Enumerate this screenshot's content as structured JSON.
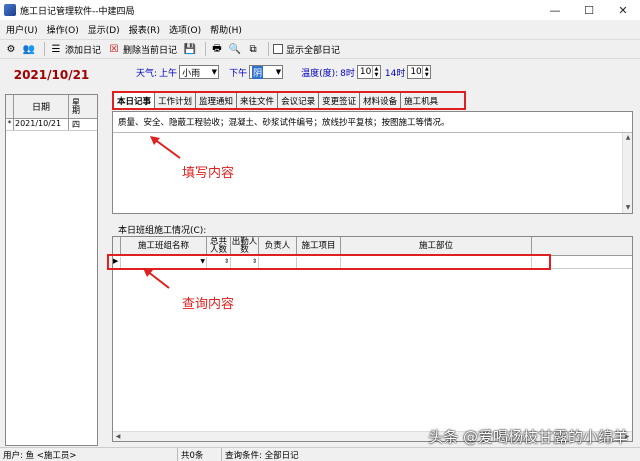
{
  "window": {
    "title": "施工日记管理软件--中建四局",
    "minimize": "—",
    "maximize": "☐",
    "close": "✕"
  },
  "menu": [
    "用户(U)",
    "操作(O)",
    "显示(D)",
    "报表(R)",
    "选项(O)",
    "帮助(H)"
  ],
  "toolbar": {
    "add_diary": "添加日记",
    "delete_diary": "删除当前日记",
    "show_all": "显示全部日记"
  },
  "left": {
    "current_date": "2021/10/21",
    "col_date": "日期",
    "col_weekday": "星期",
    "rows": [
      {
        "marker": "*",
        "date": "2021/10/21",
        "weekday": "四"
      }
    ]
  },
  "weather": {
    "label": "天气:",
    "am_label": "上午",
    "am_value": "小雨",
    "pm_label": "下午",
    "pm_value": "阴",
    "temp_label": "温度(度):",
    "t8_label": "8时",
    "t8_value": "10",
    "t14_label": "14时",
    "t14_value": "10"
  },
  "tabs": [
    "本日记事",
    "工作计划",
    "监理通知",
    "来往文件",
    "会议记录",
    "变更签证",
    "材料设备",
    "施工机具"
  ],
  "notes": {
    "hint": "质量、安全、隐蔽工程验收；混凝土、砂浆试件编号；放线抄平复核；按图施工等情况。"
  },
  "annotations": {
    "fill_content": "填写内容",
    "query_content": "查询内容"
  },
  "crew": {
    "label": "本日班组施工情况(C):",
    "columns": [
      "施工班组名称",
      "总共人数",
      "出勤人数",
      "负责人",
      "施工项目",
      "施工部位"
    ]
  },
  "status": {
    "user": "用户: 鱼 <施工员>",
    "count": "共0条",
    "query": "查询条件: 全部日记"
  },
  "watermark": "头条 @爱喝杨枝甘露的小绵羊",
  "colors": {
    "date_red": "#a00000",
    "annotation_red": "#e02020",
    "weather_blue": "#0000c0"
  }
}
